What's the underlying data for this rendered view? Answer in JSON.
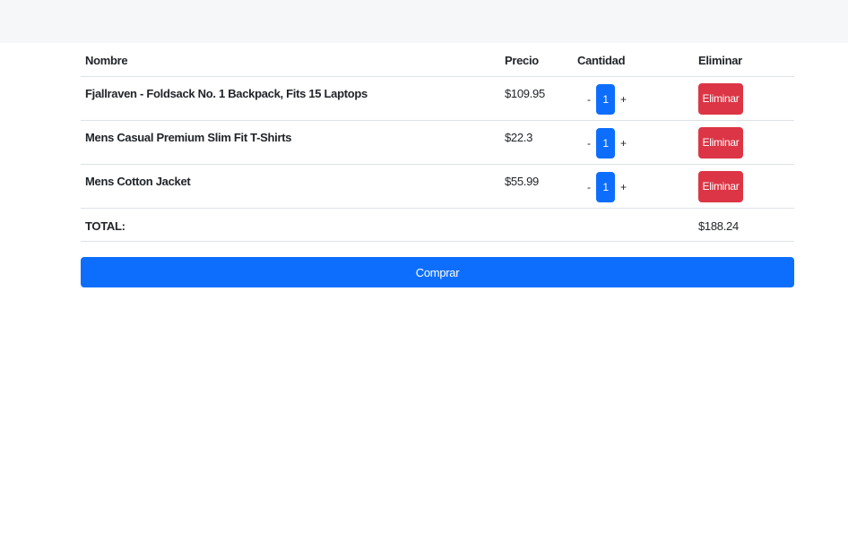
{
  "table": {
    "headers": {
      "name": "Nombre",
      "price": "Precio",
      "quantity": "Cantidad",
      "remove": "Eliminar"
    },
    "rows": [
      {
        "name": "Fjallraven - Foldsack No. 1 Backpack, Fits 15 Laptops",
        "price": "$109.95",
        "quantity": "1",
        "decrement": "-",
        "increment": "+",
        "remove_label": "Eliminar"
      },
      {
        "name": "Mens Casual Premium Slim Fit T-Shirts",
        "price": "$22.3",
        "quantity": "1",
        "decrement": "-",
        "increment": "+",
        "remove_label": "Eliminar"
      },
      {
        "name": "Mens Cotton Jacket",
        "price": "$55.99",
        "quantity": "1",
        "decrement": "-",
        "increment": "+",
        "remove_label": "Eliminar"
      }
    ],
    "total": {
      "label": "TOTAL:",
      "value": "$188.24"
    }
  },
  "actions": {
    "buy_label": "Comprar"
  },
  "colors": {
    "primary": "#0d6efd",
    "danger": "#dc3545",
    "topbar": "#f6f7f9"
  }
}
